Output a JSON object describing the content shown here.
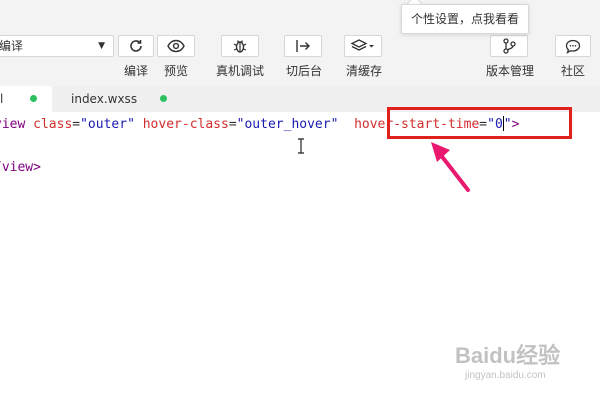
{
  "toolbar": {
    "mode_select_value": "编译",
    "buttons": [
      {
        "label": "编译",
        "icon": "refresh-icon"
      },
      {
        "label": "预览",
        "icon": "eye-icon"
      },
      {
        "label": "真机调试",
        "icon": "bug-icon"
      },
      {
        "label": "切后台",
        "icon": "switch-icon"
      },
      {
        "label": "清缓存",
        "icon": "layers-icon"
      },
      {
        "label": "版本管理",
        "icon": "branch-icon"
      },
      {
        "label": "社区",
        "icon": "chat-icon"
      }
    ],
    "tooltip": "个性设置，点我看看"
  },
  "tabs": [
    {
      "label": "l",
      "modified": true,
      "active": true
    },
    {
      "label": "index.wxss",
      "modified": true,
      "active": false
    }
  ],
  "editor": {
    "line1": {
      "tag_open": "view",
      "attr1": "class",
      "val1": "\"outer\"",
      "attr2": "hover-class",
      "val2": "\"outer_hover\"",
      "attr3": "hover-start-time",
      "eq": "=",
      "val3_a": "\"0",
      "val3_b": "\"",
      "close": ">"
    },
    "line2": {
      "close_tag": "/view>"
    }
  },
  "colors": {
    "highlight": "#e0201c",
    "arrow": "#e8196e",
    "modified_dot": "#2bbf5f"
  },
  "watermark": {
    "brand": "Baidu经验",
    "sub": "jingyan.baidu.com"
  }
}
